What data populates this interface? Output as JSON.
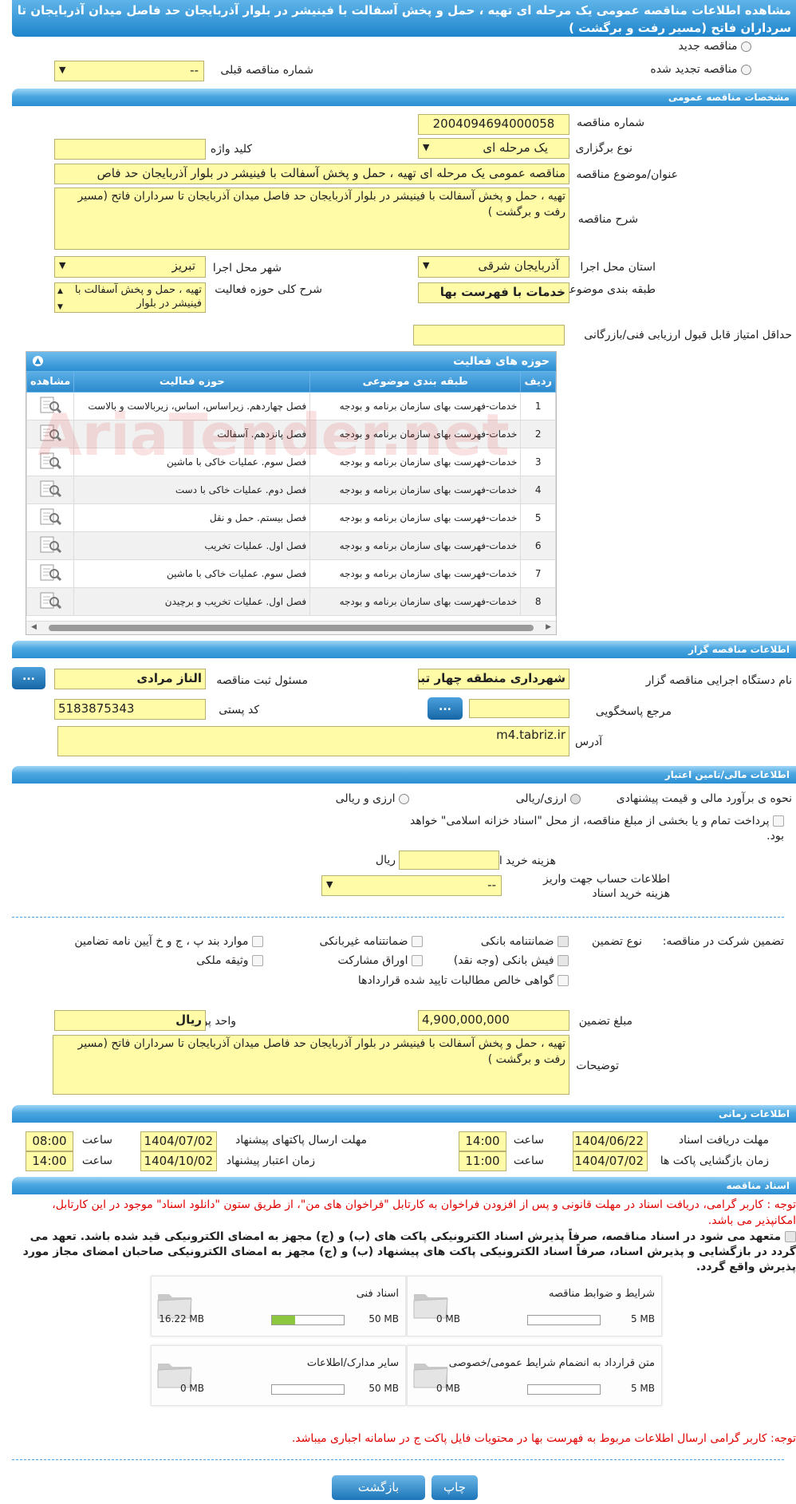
{
  "page_title": "مشاهده اطلاعات مناقصه عمومی یک مرحله ای تهیه ، حمل و پخش آسفالت با فینیشر در بلوار آذربایجان حد فاصل میدان آذربایجان تا سرداران فاتح (مسیر رفت و برگشت )",
  "type_options": {
    "new": "مناقصه جدید",
    "renewed": "مناقصه تجدید شده"
  },
  "prev_tender": {
    "label": "شماره مناقصه قبلی",
    "value": "--"
  },
  "general": {
    "heading": "مشخصات مناقصه عمومی",
    "tender_number_label": "شماره مناقصه",
    "tender_number": "2004094694000058",
    "holding_type_label": "نوع برگزاری",
    "holding_type": "یک مرحله ای",
    "keyword_label": "کلید واژه",
    "keyword": "",
    "subject_label": "عنوان/موضوع مناقصه",
    "subject": "مناقصه عمومی یک مرحله ای تهیه ، حمل و پخش آسفالت با فینیشر در بلوار آذربایجان حد فاص",
    "description_label": "شرح مناقصه",
    "description": "تهیه ، حمل و پخش آسفالت با فینیشر در بلوار آذربایجان حد فاصل میدان آذربایجان تا سرداران فاتح (مسیر رفت و برگشت )",
    "province_label": "استان محل اجرا",
    "province": "آذربایجان شرقی",
    "city_label": "شهر محل اجرا",
    "city": "تبریز",
    "category_label": "طبقه بندی موضوعی",
    "category": "خدمات با فهرست بها",
    "activity_desc_label": "شرح کلی حوزه فعالیت",
    "activity_desc": "تهیه ، حمل و پخش آسفالت با فینیشر در بلوار",
    "min_score_label": "حداقل امتیاز قابل قبول ارزیابی فنی/بازرگانی",
    "min_score": ""
  },
  "activities": {
    "heading": "حوزه های فعالیت",
    "columns": {
      "row": "ردیف",
      "category": "طبقه بندی موضوعی",
      "field": "حوزه فعالیت",
      "view": "مشاهده"
    },
    "rows": [
      {
        "n": "1",
        "category": "خدمات-فهرست بهای سازمان برنامه و بودجه",
        "field": "فصل چهاردهم. زیراساس، اساس، زیربالاست و بالاست"
      },
      {
        "n": "2",
        "category": "خدمات-فهرست بهای سازمان برنامه و بودجه",
        "field": "فصل پانزدهم. آسفالت"
      },
      {
        "n": "3",
        "category": "خدمات-فهرست بهای سازمان برنامه و بودجه",
        "field": "فصل سوم. عملیات خاکی با ماشین"
      },
      {
        "n": "4",
        "category": "خدمات-فهرست بهای سازمان برنامه و بودجه",
        "field": "فصل دوم. عملیات خاکی با دست"
      },
      {
        "n": "5",
        "category": "خدمات-فهرست بهای سازمان برنامه و بودجه",
        "field": "فصل بیستم. حمل و نقل"
      },
      {
        "n": "6",
        "category": "خدمات-فهرست بهای سازمان برنامه و بودجه",
        "field": "فصل اول. عملیات تخریب"
      },
      {
        "n": "7",
        "category": "خدمات-فهرست بهای سازمان برنامه و بودجه",
        "field": "فصل سوم. عملیات خاکی با ماشین"
      },
      {
        "n": "8",
        "category": "خدمات-فهرست بهای سازمان برنامه و بودجه",
        "field": "فصل اول. عملیات تخریب و برچیدن"
      }
    ]
  },
  "watermark": "AriaTender.net",
  "organizer": {
    "heading": "اطلاعات مناقصه گزار",
    "org_label": "نام دستگاه اجرایی مناقصه گزار",
    "org": "شهرداری منطقه چهار تبریز",
    "official_label": "مسئول ثبت مناقصه",
    "official": "الناز مرادی",
    "ref_label": "مرجع پاسخگویی",
    "ref": "",
    "postal_label": "کد پستی",
    "postal": "5183875343",
    "address_label": "آدرس",
    "address": "m4.tabriz.ir",
    "dots": "..."
  },
  "finance": {
    "heading": "اطلاعات مالی/تامین اعتبار",
    "estimate_label": "نحوه ی برآورد مالی و قیمت پیشنهادی",
    "opt_rial_fx": "ارزی/ریالی",
    "opt_fx_and_rial": "ارزی و ریالی",
    "treasury_text": "پرداخت تمام و یا بخشی از مبلغ مناقصه، از محل \"اسناد خزانه اسلامی\" خواهد بود.",
    "doc_fee_label": "هزینه خرید اسناد",
    "doc_fee": "",
    "doc_fee_unit": "ریال",
    "account_label": "اطلاعات حساب جهت واریز هزینه خرید اسناد",
    "account": "--"
  },
  "guarantee": {
    "label": "تضمین شرکت در مناقصه:",
    "type_label": "نوع تضمین",
    "options": {
      "bank": "ضمانتنامه بانکی",
      "nonbank": "ضمانتنامه غیربانکی",
      "cases": "موارد بند پ ، ج و خ آیین نامه تضامین",
      "cash": "فیش بانکی (وجه نقد)",
      "bonds": "اوراق مشارکت",
      "property": "وثیقه ملکی",
      "receivables": "گواهی خالص مطالبات تایید شده قراردادها"
    },
    "amount_label": "مبلغ تضمین",
    "amount": "4,900,000,000",
    "currency_label": "واحد پول",
    "currency": "ریال",
    "notes_label": "توضیحات",
    "notes": "تهیه ، حمل و پخش آسفالت با فینیشر در بلوار آذربایجان حد فاصل میدان آذربایجان تا سرداران فاتح (مسیر رفت و برگشت )"
  },
  "timing": {
    "heading": "اطلاعات زمانی",
    "doc_receive_label": "مهلت دریافت اسناد",
    "doc_receive_date": "1404/06/22",
    "doc_receive_time": "14:00",
    "send_label": "مهلت ارسال پاکتهای پیشنهاد",
    "send_date": "1404/07/02",
    "send_time": "08:00",
    "open_label": "زمان بازگشایی پاکت ها",
    "open_date": "1404/07/02",
    "open_time": "11:00",
    "valid_label": "زمان اعتبار پیشنهاد",
    "valid_date": "1404/10/02",
    "valid_time": "14:00",
    "time_label": "ساعت"
  },
  "documents": {
    "heading": "اسناد مناقصه",
    "notice": "توجه : کاربر گرامی، دریافت اسناد در مهلت قانونی و پس از افزودن فراخوان به کارتابل \"فراخوان های من\"، از طریق ستون \"دانلود اسناد\" موجود در این کارتابل، امکانپذیر می باشد.",
    "pledge": "متعهد می شود در اسناد مناقصه، صرفاً پذیرش اسناد الکترونیکی پاکت های (ب) و (ج) مجهز به امضای الکترونیکی قید شده باشد. تعهد می گردد در بازگشایی و پذیرش اسناد، صرفاً اسناد الکترونیکی پاکت های پیشنهاد (ب) و (ج) مجهز به امضای الکترونیکی صاحبان امضای مجاز مورد پذیرش واقع گردد.",
    "cards": [
      {
        "title": "شرایط و ضوابط مناقصه",
        "used": "0 MB",
        "max": "5 MB",
        "fill": 0
      },
      {
        "title": "اسناد فنی",
        "used": "16.22 MB",
        "max": "50 MB",
        "fill": 0.3244
      },
      {
        "title": "متن قرارداد به انضمام شرایط عمومی/خصوصی",
        "used": "0 MB",
        "max": "5 MB",
        "fill": 0
      },
      {
        "title": "سایر مدارک/اطلاعات",
        "used": "0 MB",
        "max": "50 MB",
        "fill": 0
      }
    ],
    "bottom_note": "توجه: کاربر گرامی ارسال اطلاعات مربوط به فهرست بها در محتویات فایل پاکت ج در سامانه اجباری میباشد."
  },
  "buttons": {
    "print": "چاپ",
    "back": "بازگشت"
  }
}
